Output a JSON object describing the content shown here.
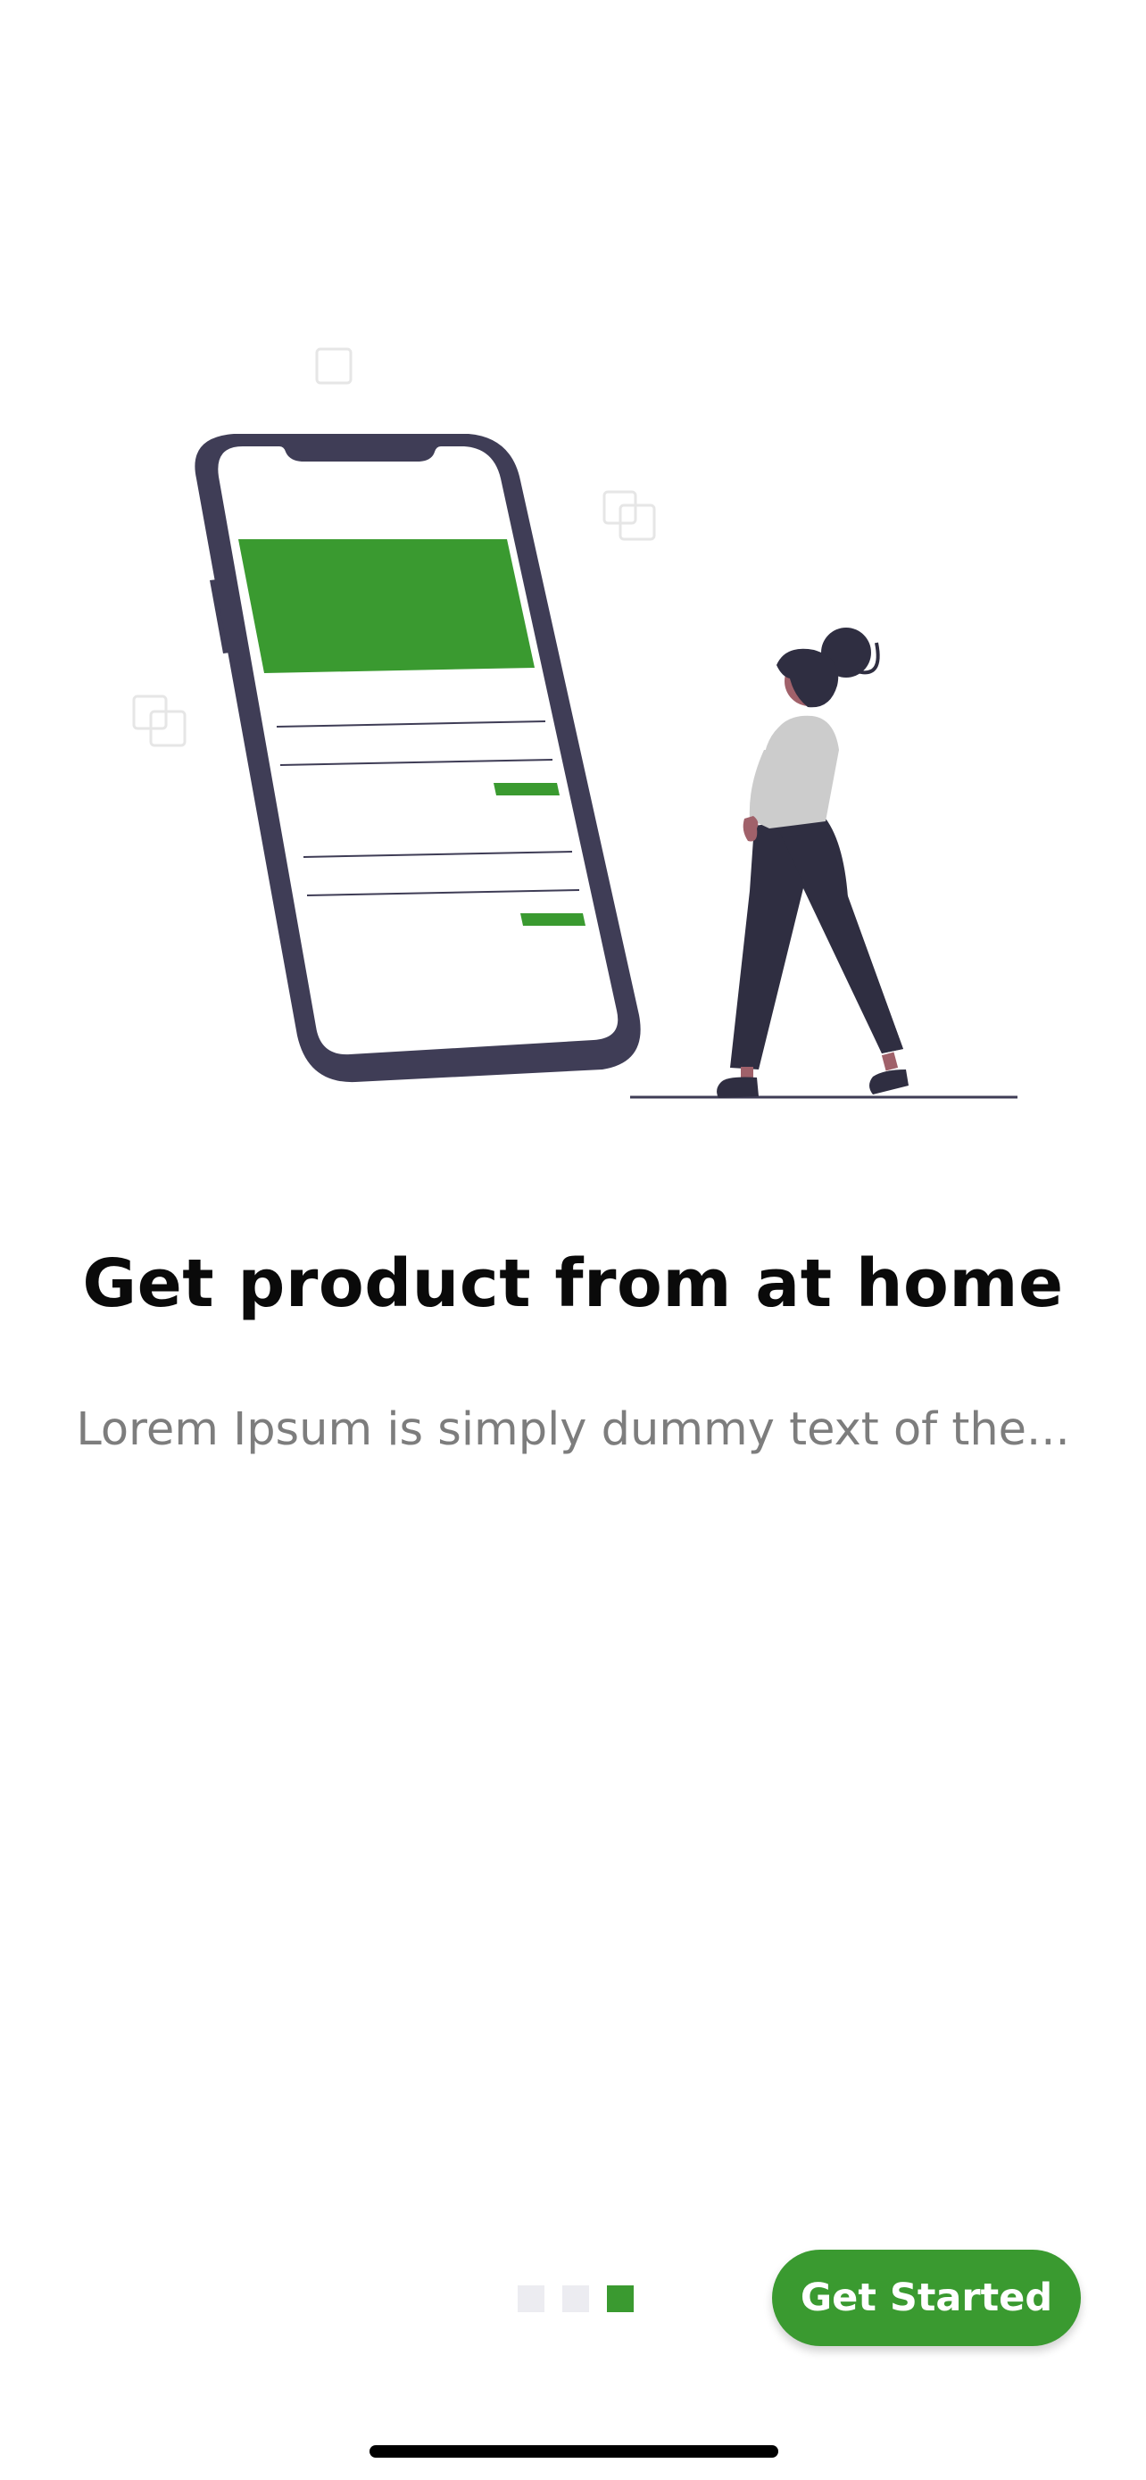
{
  "onboarding": {
    "title": "Get product from at home",
    "subtitle": "Lorem Ipsum is simply dummy text of the...",
    "illustration_icon": "woman-with-phone-illustration",
    "page_indicator": {
      "total": 3,
      "current": 3
    },
    "cta_label": "Get Started"
  },
  "colors": {
    "accent": "#3a9a30",
    "phone_frame": "#3f3d56",
    "title": "#0a0a0a",
    "subtitle": "#7d7d7d",
    "dot_inactive": "#ececf1"
  }
}
